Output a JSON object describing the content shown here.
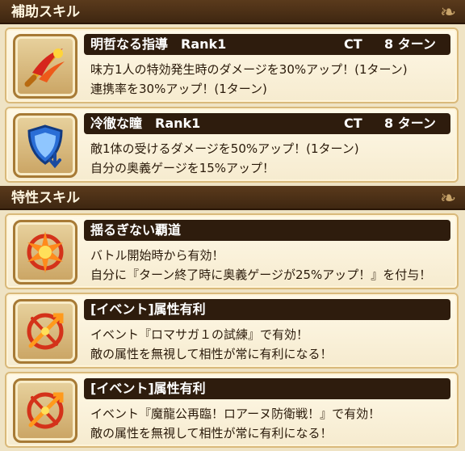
{
  "support_section": {
    "title": "補助スキル"
  },
  "trait_section": {
    "title": "特性スキル"
  },
  "skills": [
    {
      "name": "明哲なる指導　Rank1",
      "ct": "CT",
      "turn": "8 ターン",
      "lines": [
        "味方1人の特効発生時のダメージを30%アップ！(1ターン)",
        "連携率を30%アップ！(1ターン)"
      ],
      "icon": "sword-slash-icon"
    },
    {
      "name": "冷徹な瞳　Rank1",
      "ct": "CT",
      "turn": "8 ターン",
      "lines": [
        "敵1体の受けるダメージを50%アップ！(1ターン)",
        "自分の奥義ゲージを15%アップ！"
      ],
      "icon": "shield-down-icon"
    }
  ],
  "traits": [
    {
      "name": "揺るぎない覇道",
      "lines": [
        "バトル開始時から有効！",
        "自分に『ターン終了時に奥義ゲージが25%アップ！』を付与！"
      ],
      "icon": "sun-burst-icon"
    },
    {
      "name": "[イベント]属性有利",
      "lines": [
        "イベント『ロマサガ１の試練』で有効！",
        "敵の属性を無視して相性が常に有利になる！"
      ],
      "icon": "crossed-arrows-icon"
    },
    {
      "name": "[イベント]属性有利",
      "lines": [
        "イベント『魔龍公再臨！ロアーヌ防衛戦！』で有効！",
        "敵の属性を無視して相性が常に有利になる！"
      ],
      "icon": "crossed-arrows-icon"
    }
  ],
  "colors": {
    "header": "#4a2f16",
    "title_bar": "#2e1c0d",
    "card_border": "#d9b97a"
  }
}
